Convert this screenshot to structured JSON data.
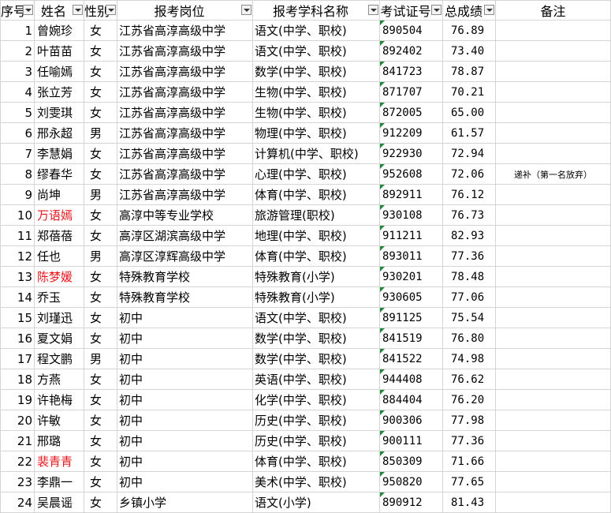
{
  "headers": [
    "序号",
    "姓名",
    "性别",
    "报考岗位",
    "报考学科名称",
    "考试证号",
    "总成绩",
    "备注"
  ],
  "rows": [
    {
      "no": "1",
      "name": "曾婉珍",
      "gender": "女",
      "unit": "江苏省高淳高级中学",
      "subject": "语文(中学、职校)",
      "ticket": "890504",
      "score": "76.89",
      "note": ""
    },
    {
      "no": "2",
      "name": "叶苗苗",
      "gender": "女",
      "unit": "江苏省高淳高级中学",
      "subject": "语文(中学、职校)",
      "ticket": "892402",
      "score": "73.40",
      "note": ""
    },
    {
      "no": "3",
      "name": "任喻嫣",
      "gender": "女",
      "unit": "江苏省高淳高级中学",
      "subject": "数学(中学、职校)",
      "ticket": "841723",
      "score": "78.87",
      "note": ""
    },
    {
      "no": "4",
      "name": "张立芳",
      "gender": "女",
      "unit": "江苏省高淳高级中学",
      "subject": "生物(中学、职校)",
      "ticket": "871707",
      "score": "70.21",
      "note": ""
    },
    {
      "no": "5",
      "name": "刘雯琪",
      "gender": "女",
      "unit": "江苏省高淳高级中学",
      "subject": "生物(中学、职校)",
      "ticket": "872005",
      "score": "65.00",
      "note": ""
    },
    {
      "no": "6",
      "name": "邢永超",
      "gender": "男",
      "unit": "江苏省高淳高级中学",
      "subject": "物理(中学、职校)",
      "ticket": "912209",
      "score": "61.57",
      "note": ""
    },
    {
      "no": "7",
      "name": "李慧娟",
      "gender": "女",
      "unit": "江苏省高淳高级中学",
      "subject": "计算机(中学、职校)",
      "ticket": "922930",
      "score": "72.94",
      "note": ""
    },
    {
      "no": "8",
      "name": "缪春华",
      "gender": "女",
      "unit": "江苏省高淳高级中学",
      "subject": "心理(中学、职校)",
      "ticket": "952608",
      "score": "72.06",
      "note": "递补（第一名放弃）"
    },
    {
      "no": "9",
      "name": "尚坤",
      "gender": "男",
      "unit": "江苏省高淳高级中学",
      "subject": "体育(中学、职校)",
      "ticket": "892911",
      "score": "76.12",
      "note": ""
    },
    {
      "no": "10",
      "name": "万语嫣",
      "gender": "女",
      "unit": "高淳中等专业学校",
      "subject": "旅游管理(职校)",
      "ticket": "930108",
      "score": "76.73",
      "note": "",
      "red": true
    },
    {
      "no": "11",
      "name": "郑蓓蓓",
      "gender": "女",
      "unit": "高淳区湖滨高级中学",
      "subject": "地理(中学、职校)",
      "ticket": "911211",
      "score": "82.93",
      "note": ""
    },
    {
      "no": "12",
      "name": "任也",
      "gender": "男",
      "unit": "高淳区淳辉高级中学",
      "subject": "体育(中学、职校)",
      "ticket": "893011",
      "score": "77.36",
      "note": ""
    },
    {
      "no": "13",
      "name": "陈梦媛",
      "gender": "女",
      "unit": "特殊教育学校",
      "subject": "特殊教育(小学)",
      "ticket": "930201",
      "score": "78.48",
      "note": "",
      "red": true
    },
    {
      "no": "14",
      "name": "乔玉",
      "gender": "女",
      "unit": "特殊教育学校",
      "subject": "特殊教育(小学)",
      "ticket": "930605",
      "score": "77.06",
      "note": ""
    },
    {
      "no": "15",
      "name": "刘瑾迅",
      "gender": "女",
      "unit": "初中",
      "subject": "语文(中学、职校)",
      "ticket": "891125",
      "score": "75.54",
      "note": ""
    },
    {
      "no": "16",
      "name": "夏文娟",
      "gender": "女",
      "unit": "初中",
      "subject": "数学(中学、职校)",
      "ticket": "841519",
      "score": "76.80",
      "note": ""
    },
    {
      "no": "17",
      "name": "程文鹏",
      "gender": "男",
      "unit": "初中",
      "subject": "数学(中学、职校)",
      "ticket": "841522",
      "score": "74.98",
      "note": ""
    },
    {
      "no": "18",
      "name": "方燕",
      "gender": "女",
      "unit": "初中",
      "subject": "英语(中学、职校)",
      "ticket": "944408",
      "score": "76.62",
      "note": ""
    },
    {
      "no": "19",
      "name": "许艳梅",
      "gender": "女",
      "unit": "初中",
      "subject": "化学(中学、职校)",
      "ticket": "884404",
      "score": "76.20",
      "note": ""
    },
    {
      "no": "20",
      "name": "许敏",
      "gender": "女",
      "unit": "初中",
      "subject": "历史(中学、职校)",
      "ticket": "900306",
      "score": "77.98",
      "note": ""
    },
    {
      "no": "21",
      "name": "邢璐",
      "gender": "女",
      "unit": "初中",
      "subject": "历史(中学、职校)",
      "ticket": "900111",
      "score": "77.36",
      "note": ""
    },
    {
      "no": "22",
      "name": "裴青青",
      "gender": "女",
      "unit": "初中",
      "subject": "体育(中学、职校)",
      "ticket": "850309",
      "score": "71.66",
      "note": "",
      "red": true
    },
    {
      "no": "23",
      "name": "李鼎一",
      "gender": "女",
      "unit": "初中",
      "subject": "美术(中学、职校)",
      "ticket": "950820",
      "score": "77.65",
      "note": ""
    },
    {
      "no": "24",
      "name": "吴晨谣",
      "gender": "女",
      "unit": "乡镇小学",
      "subject": "语文(小学)",
      "ticket": "890912",
      "score": "81.43",
      "note": ""
    }
  ],
  "colors": {
    "grid": "#d4d4d4",
    "red_name": "#e8171d",
    "ticket_marker": "#1f8b3a"
  }
}
